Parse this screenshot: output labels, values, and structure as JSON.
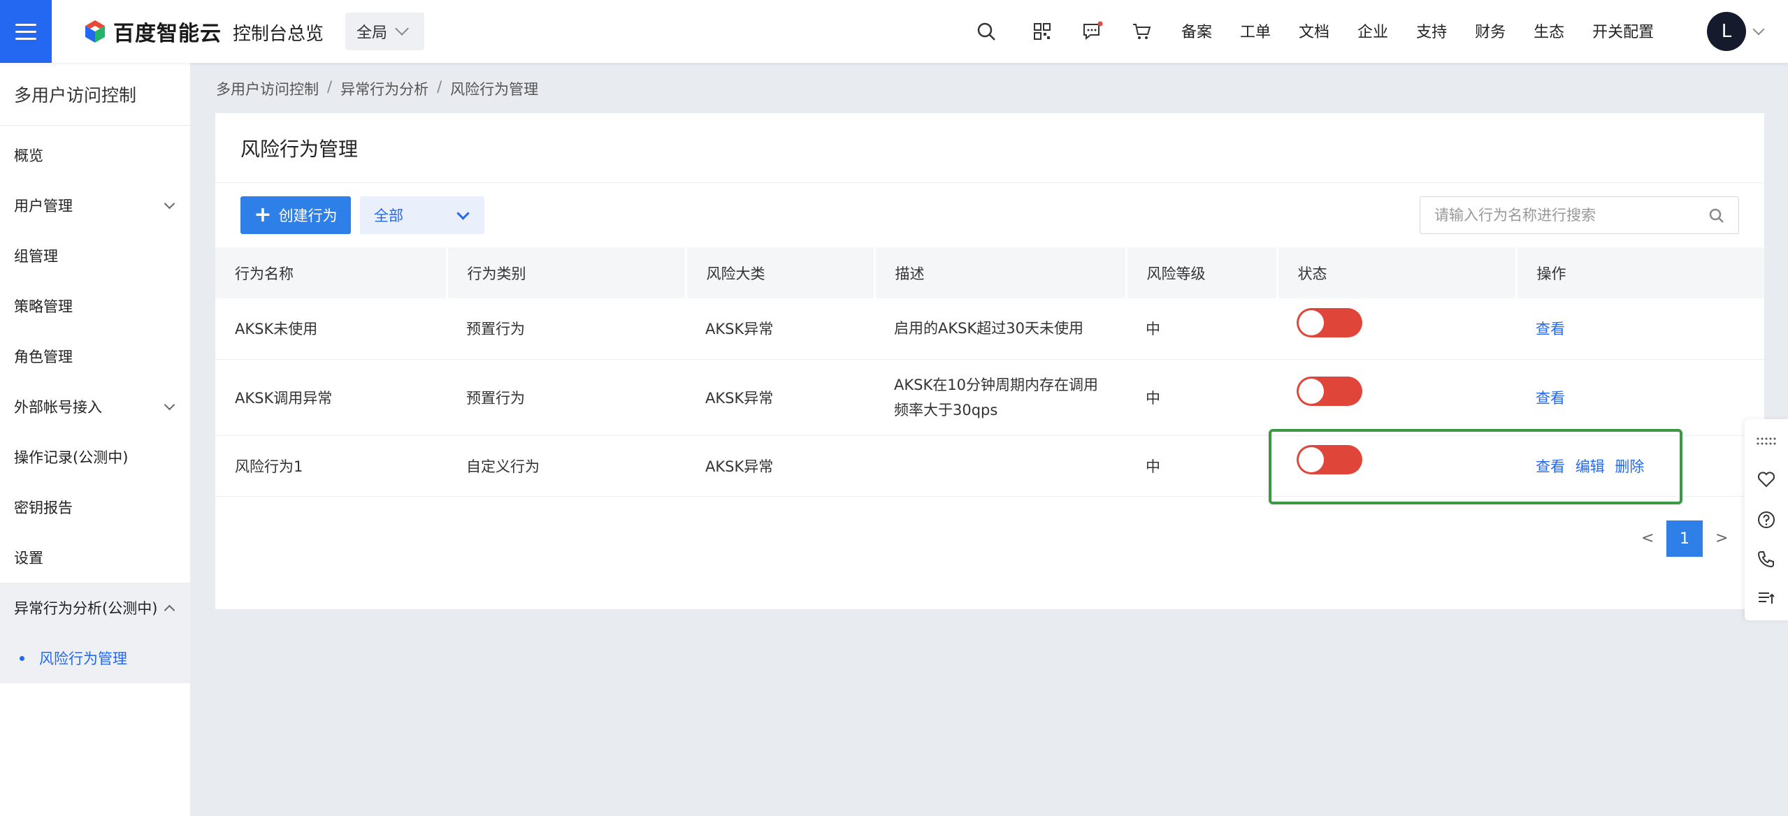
{
  "header": {
    "logo_text": "百度智能云",
    "console_title": "控制台总览",
    "region": "全局",
    "nav": [
      "备案",
      "工单",
      "文档",
      "企业",
      "支持",
      "财务",
      "生态",
      "开关配置"
    ],
    "avatar_letter": "L"
  },
  "sidebar": {
    "title": "多用户访问控制",
    "items": [
      {
        "label": "概览"
      },
      {
        "label": "用户管理"
      },
      {
        "label": "组管理"
      },
      {
        "label": "策略管理"
      },
      {
        "label": "角色管理"
      },
      {
        "label": "外部帐号接入"
      },
      {
        "label": "操作记录(公测中)"
      },
      {
        "label": "密钥报告"
      },
      {
        "label": "设置"
      },
      {
        "label": "异常行为分析(公测中)"
      }
    ],
    "sub_item": "风险行为管理"
  },
  "breadcrumb": [
    "多用户访问控制",
    "异常行为分析",
    "风险行为管理"
  ],
  "breadcrumb_sep": "/",
  "panel": {
    "title": "风险行为管理",
    "create_label": "创建行为",
    "create_plus": "+",
    "filter_value": "全部",
    "search_placeholder": "请输入行为名称进行搜索"
  },
  "table": {
    "headers": [
      "行为名称",
      "行为类别",
      "风险大类",
      "描述",
      "风险等级",
      "状态",
      "操作"
    ],
    "rows": [
      {
        "name": "AKSK未使用",
        "type": "预置行为",
        "category": "AKSK异常",
        "desc": "启用的AKSK超过30天未使用",
        "level": "中",
        "status_on": false,
        "actions": [
          "查看"
        ]
      },
      {
        "name": "AKSK调用异常",
        "type": "预置行为",
        "category": "AKSK异常",
        "desc": "AKSK在10分钟周期内存在调用频率大于30qps",
        "level": "中",
        "status_on": false,
        "actions": [
          "查看"
        ]
      },
      {
        "name": "风险行为1",
        "type": "自定义行为",
        "category": "AKSK异常",
        "desc": "",
        "level": "中",
        "status_on": false,
        "actions": [
          "查看",
          "编辑",
          "删除"
        ]
      }
    ]
  },
  "pagination": {
    "prev": "<",
    "current": "1",
    "next": ">"
  },
  "colors": {
    "accent": "#2468f2",
    "toggle": "#e0453a",
    "highlight": "#3a9a44"
  }
}
